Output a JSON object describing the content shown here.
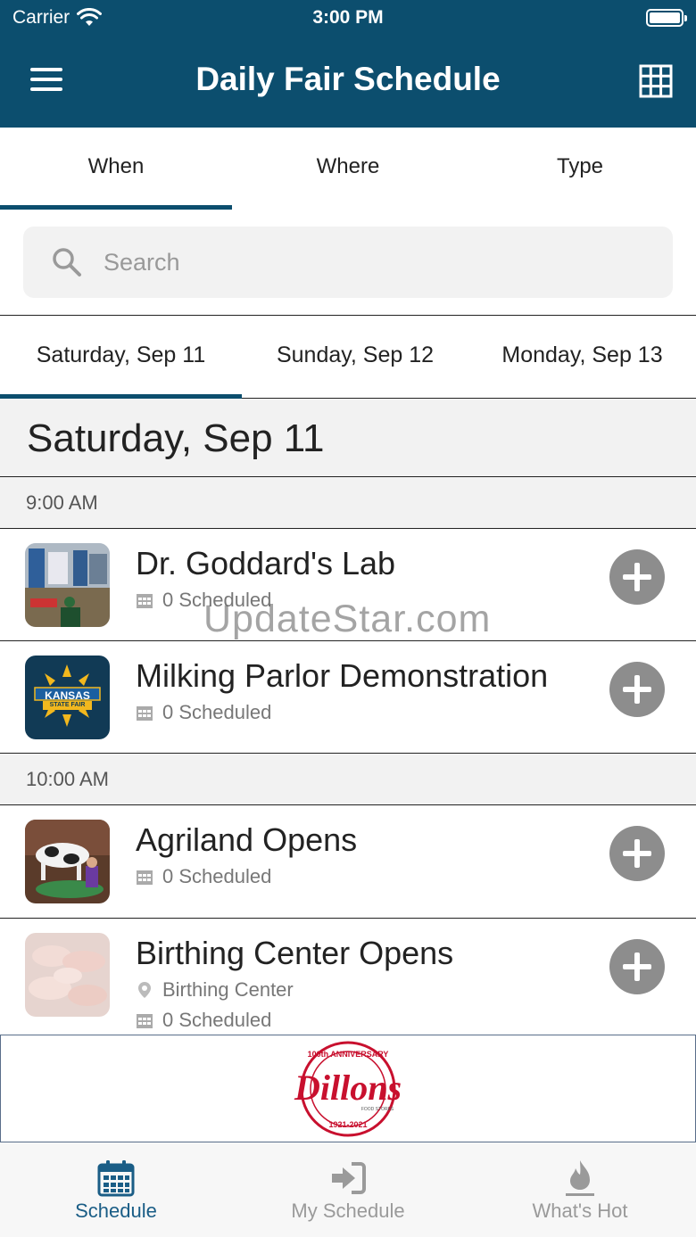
{
  "status_bar": {
    "carrier": "Carrier",
    "time": "3:00 PM"
  },
  "header": {
    "title": "Daily Fair Schedule",
    "menu_icon": "hamburger-menu-icon",
    "grid_icon": "grid-view-icon"
  },
  "top_tabs": [
    {
      "label": "When",
      "active": true
    },
    {
      "label": "Where",
      "active": false
    },
    {
      "label": "Type",
      "active": false
    }
  ],
  "search": {
    "placeholder": "Search",
    "value": ""
  },
  "date_tabs": [
    {
      "label": "Saturday, Sep 11",
      "active": true
    },
    {
      "label": "Sunday, Sep 12",
      "active": false
    },
    {
      "label": "Monday, Sep 13",
      "active": false
    }
  ],
  "day_heading": "Saturday, Sep 11",
  "time_groups": [
    {
      "time": "9:00 AM",
      "events": [
        {
          "title": "Dr. Goddard's Lab",
          "scheduled": "0 Scheduled"
        },
        {
          "title": "Milking Parlor Demonstration",
          "scheduled": "0 Scheduled"
        }
      ]
    },
    {
      "time": "10:00 AM",
      "events": [
        {
          "title": "Agriland Opens",
          "scheduled": "0 Scheduled"
        },
        {
          "title": "Birthing Center Opens",
          "location": "Birthing Center",
          "scheduled": "0 Scheduled"
        }
      ]
    }
  ],
  "kansas_logo": {
    "line1": "KANSAS",
    "line2": "STATE FAIR"
  },
  "watermark": "UpdateStar.com",
  "ad": {
    "brand": "Dillons",
    "tagline": "100th ANNIVERSARY",
    "years": "1921-2021",
    "sub": "FOOD STORES"
  },
  "bottom_nav": [
    {
      "label": "Schedule",
      "icon": "calendar-icon",
      "active": true
    },
    {
      "label": "My Schedule",
      "icon": "sign-in-icon",
      "active": false
    },
    {
      "label": "What's Hot",
      "icon": "flame-icon",
      "active": false
    }
  ],
  "colors": {
    "header": "#0c4e6e",
    "accent": "#1a5d86",
    "add_button": "#8d8d8d"
  }
}
